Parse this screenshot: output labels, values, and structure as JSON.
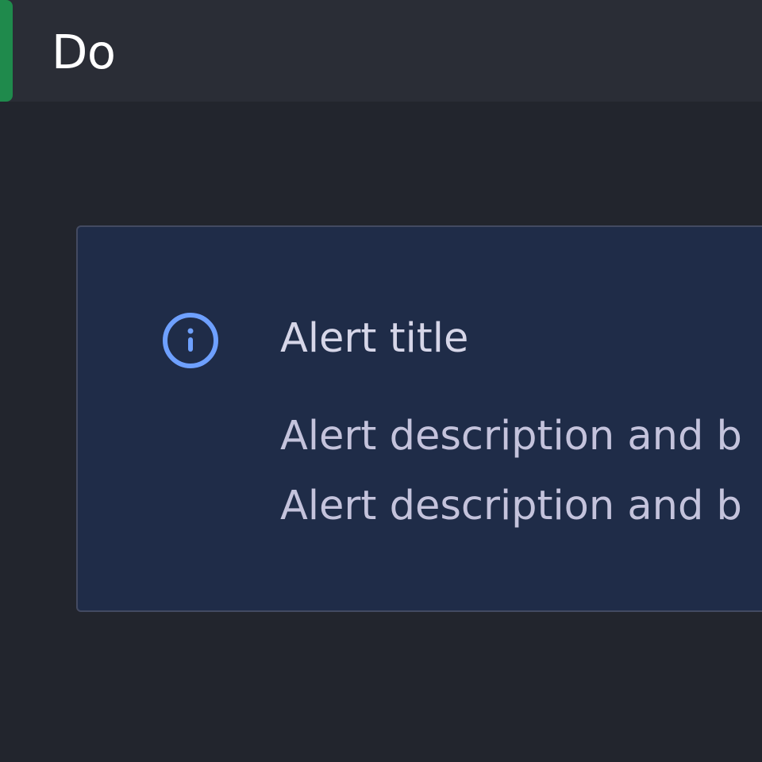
{
  "header": {
    "title": "Do",
    "accent_color": "#1f8a4c"
  },
  "alert": {
    "variant": "info",
    "icon": "info-circle-icon",
    "icon_color": "#6ea0ff",
    "title": "Alert title",
    "description_lines": [
      "Alert description and b",
      "Alert description and b"
    ]
  }
}
